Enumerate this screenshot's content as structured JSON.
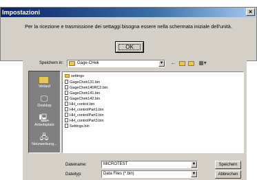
{
  "message_dialog": {
    "title": "Impostazioni",
    "close": "×",
    "text": "Per la ricezione e trasmissione dei settaggi bisogna essere nella schermata iniziale dell'unità.",
    "ok_label": "OK"
  },
  "file_dialog": {
    "save_in_label": "Speichern in:",
    "current_folder": "Gage-CHek",
    "places": [
      {
        "label": "Verlauf",
        "icon": "history-icon"
      },
      {
        "label": "Desktop",
        "icon": "desktop-icon"
      },
      {
        "label": "Arbeitsplatz",
        "icon": "my-computer-icon"
      },
      {
        "label": "Netzwerkung...",
        "icon": "network-icon"
      }
    ],
    "files": [
      {
        "name": "settings",
        "type": "folder"
      },
      {
        "name": "GageChek131.bin",
        "type": "file"
      },
      {
        "name": "GageChek140RC2.bin",
        "type": "file"
      },
      {
        "name": "GageChek141.bin",
        "type": "file"
      },
      {
        "name": "GageChek142.bin",
        "type": "file"
      },
      {
        "name": "HH_control.bin",
        "type": "file"
      },
      {
        "name": "HH_controlPart1.bin",
        "type": "file"
      },
      {
        "name": "HH_controlPart2.bin",
        "type": "file"
      },
      {
        "name": "HH_controlPart3.bin",
        "type": "file"
      },
      {
        "name": "Settings.bin",
        "type": "file"
      }
    ],
    "filename_label": "Dateiname:",
    "filename_value": "MICROTEST",
    "filetype_label": "Dateityp:",
    "filetype_value": "Data Files (*.bin)",
    "save_button": "Speichern",
    "cancel_button": "Abbrechen"
  }
}
